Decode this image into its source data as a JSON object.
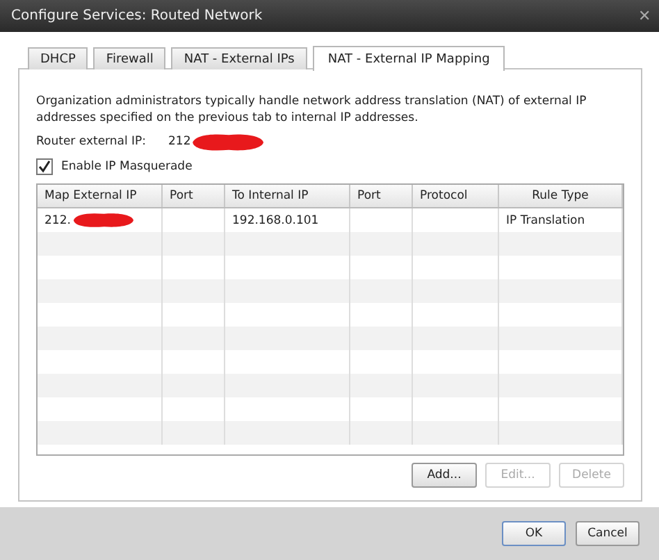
{
  "window": {
    "title": "Configure Services: Routed Network",
    "close": "✕"
  },
  "tabs": [
    {
      "label": "DHCP",
      "selected": false
    },
    {
      "label": "Firewall",
      "selected": false
    },
    {
      "label": "NAT - External IPs",
      "selected": false
    },
    {
      "label": "NAT - External IP Mapping",
      "selected": true
    }
  ],
  "description": "Organization administrators typically handle network address translation (NAT) of external IP addresses specified on the previous tab to internal IP addresses.",
  "router_ip": {
    "label": "Router external IP:",
    "value": "212"
  },
  "masquerade": {
    "label": "Enable IP Masquerade",
    "checked": true
  },
  "table": {
    "columns": [
      "Map External IP",
      "Port",
      "To Internal IP",
      "Port",
      "Protocol",
      "Rule Type"
    ],
    "rows": [
      {
        "cells": [
          "212.",
          "",
          "192.168.0.101",
          "",
          "",
          "IP Translation"
        ],
        "redacted": true
      }
    ]
  },
  "table_buttons": [
    {
      "label": "Add...",
      "disabled": false
    },
    {
      "label": "Edit...",
      "disabled": true
    },
    {
      "label": "Delete",
      "disabled": true
    }
  ],
  "footer_buttons": [
    {
      "label": "OK",
      "default": true
    },
    {
      "label": "Cancel",
      "default": false
    }
  ]
}
